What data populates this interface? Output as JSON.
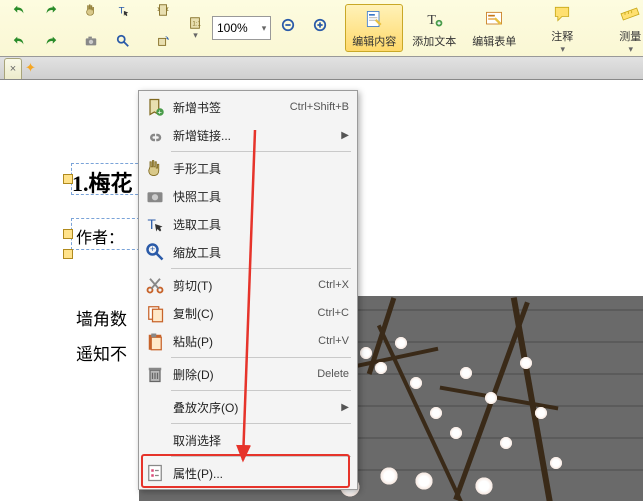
{
  "toolbar": {
    "zoom": "100%",
    "edit_content": "编辑内容",
    "add_text": "添加文本",
    "edit_form": "编辑表单",
    "annotate": "注释",
    "measure": "测量"
  },
  "doc": {
    "heading": "1.梅花",
    "author_label": "作者：",
    "line1": "墙角数",
    "line2": "遥知不"
  },
  "menu": {
    "new_bookmark": "新增书签",
    "new_bookmark_sc": "Ctrl+Shift+B",
    "new_link": "新增链接...",
    "hand": "手形工具",
    "snapshot": "快照工具",
    "select": "选取工具",
    "zoom": "缩放工具",
    "cut": "剪切(T)",
    "cut_sc": "Ctrl+X",
    "copy": "复制(C)",
    "copy_sc": "Ctrl+C",
    "paste": "粘贴(P)",
    "paste_sc": "Ctrl+V",
    "delete": "删除(D)",
    "delete_sc": "Delete",
    "arrange": "叠放次序(O)",
    "deselect": "取消选择",
    "properties": "属性(P)..."
  }
}
